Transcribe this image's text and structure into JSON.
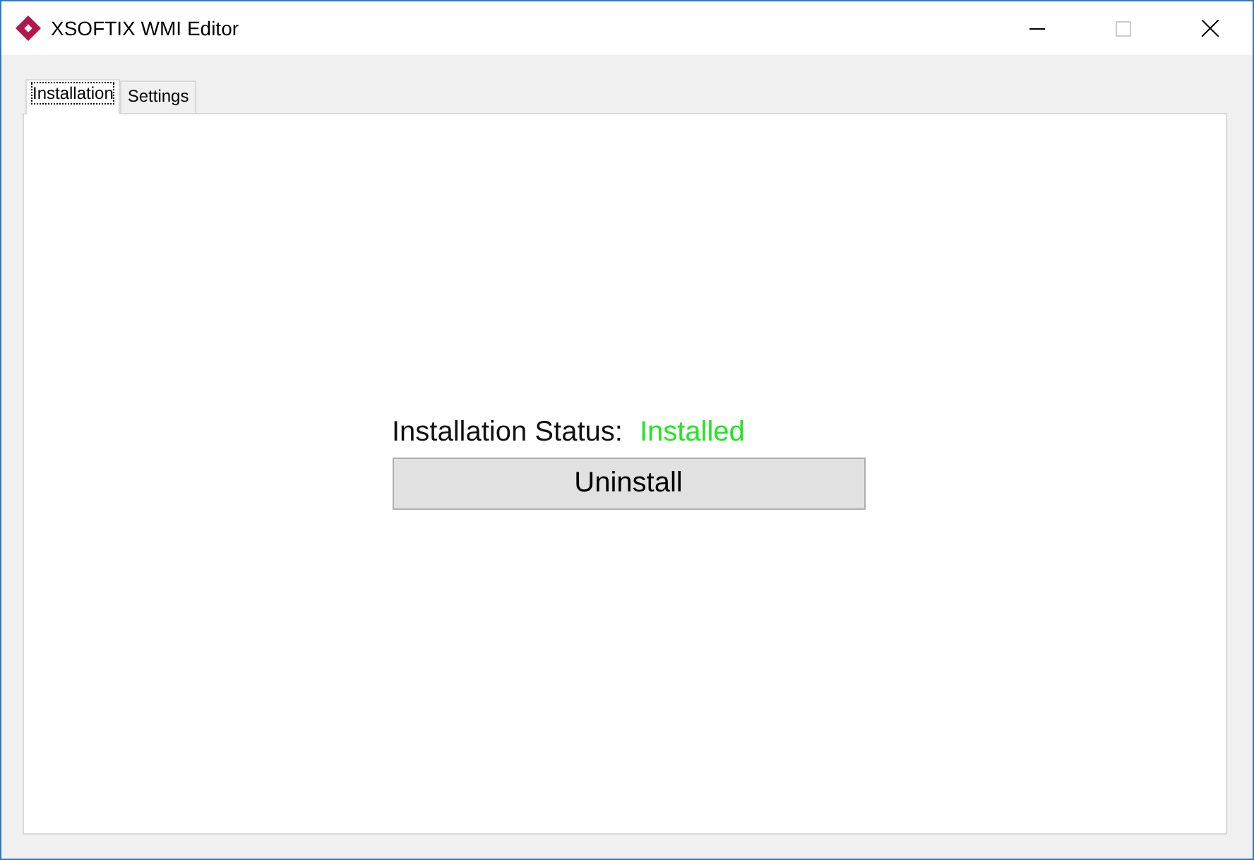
{
  "window": {
    "title": "XSOFTIX WMI Editor"
  },
  "tabs": [
    {
      "label": "Installation",
      "selected": true
    },
    {
      "label": "Settings",
      "selected": false
    }
  ],
  "status": {
    "label": "Installation Status:",
    "value": "Installed"
  },
  "button": {
    "label": "Uninstall"
  }
}
